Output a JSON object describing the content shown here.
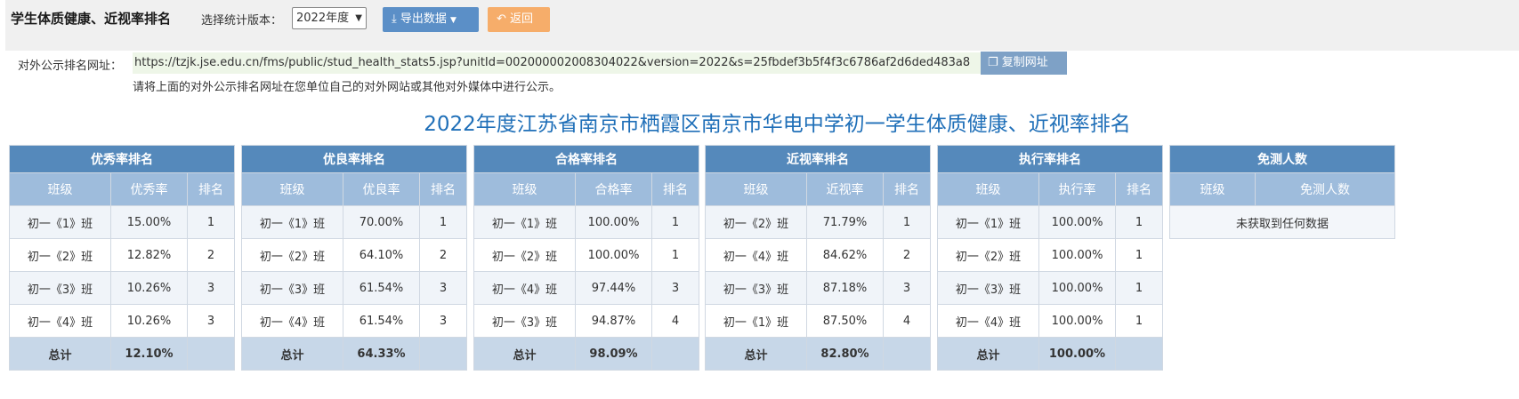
{
  "page": {
    "title": "学生体质健康、近视率排名",
    "version_label": "选择统计版本：",
    "version_selected": "2022年度",
    "export_label": "导出数据",
    "back_label": "返回"
  },
  "url_section": {
    "label": "对外公示排名网址：",
    "url": "https://tzjk.jse.edu.cn/fms/public/stud_health_stats5.jsp?unitId=002000002008304022&version=2022&s=25fbdef3b5f4f3c6786af2d6ded483a8",
    "copy_label": "复制网址",
    "hint": "请将上面的对外公示排名网址在您单位自己的对外网站或其他对外媒体中进行公示。"
  },
  "report_title": "2022年度江苏省南京市栖霞区南京市华电中学初一学生体质健康、近视率排名",
  "panels": [
    {
      "title": "优秀率排名",
      "headers": [
        "班级",
        "优秀率",
        "排名"
      ],
      "rows": [
        [
          "初一《1》班",
          "15.00%",
          "1"
        ],
        [
          "初一《2》班",
          "12.82%",
          "2"
        ],
        [
          "初一《3》班",
          "10.26%",
          "3"
        ],
        [
          "初一《4》班",
          "10.26%",
          "3"
        ]
      ],
      "total": [
        "总计",
        "12.10%",
        ""
      ]
    },
    {
      "title": "优良率排名",
      "headers": [
        "班级",
        "优良率",
        "排名"
      ],
      "rows": [
        [
          "初一《1》班",
          "70.00%",
          "1"
        ],
        [
          "初一《2》班",
          "64.10%",
          "2"
        ],
        [
          "初一《3》班",
          "61.54%",
          "3"
        ],
        [
          "初一《4》班",
          "61.54%",
          "3"
        ]
      ],
      "total": [
        "总计",
        "64.33%",
        ""
      ]
    },
    {
      "title": "合格率排名",
      "headers": [
        "班级",
        "合格率",
        "排名"
      ],
      "rows": [
        [
          "初一《1》班",
          "100.00%",
          "1"
        ],
        [
          "初一《2》班",
          "100.00%",
          "1"
        ],
        [
          "初一《4》班",
          "97.44%",
          "3"
        ],
        [
          "初一《3》班",
          "94.87%",
          "4"
        ]
      ],
      "total": [
        "总计",
        "98.09%",
        ""
      ]
    },
    {
      "title": "近视率排名",
      "headers": [
        "班级",
        "近视率",
        "排名"
      ],
      "rows": [
        [
          "初一《2》班",
          "71.79%",
          "1"
        ],
        [
          "初一《4》班",
          "84.62%",
          "2"
        ],
        [
          "初一《3》班",
          "87.18%",
          "3"
        ],
        [
          "初一《1》班",
          "87.50%",
          "4"
        ]
      ],
      "total": [
        "总计",
        "82.80%",
        ""
      ]
    },
    {
      "title": "执行率排名",
      "headers": [
        "班级",
        "执行率",
        "排名"
      ],
      "rows": [
        [
          "初一《1》班",
          "100.00%",
          "1"
        ],
        [
          "初一《2》班",
          "100.00%",
          "1"
        ],
        [
          "初一《3》班",
          "100.00%",
          "1"
        ],
        [
          "初一《4》班",
          "100.00%",
          "1"
        ]
      ],
      "total": [
        "总计",
        "100.00%",
        ""
      ]
    }
  ],
  "exempt_panel": {
    "title": "免测人数",
    "headers": [
      "班级",
      "免测人数"
    ],
    "no_data": "未获取到任何数据"
  }
}
